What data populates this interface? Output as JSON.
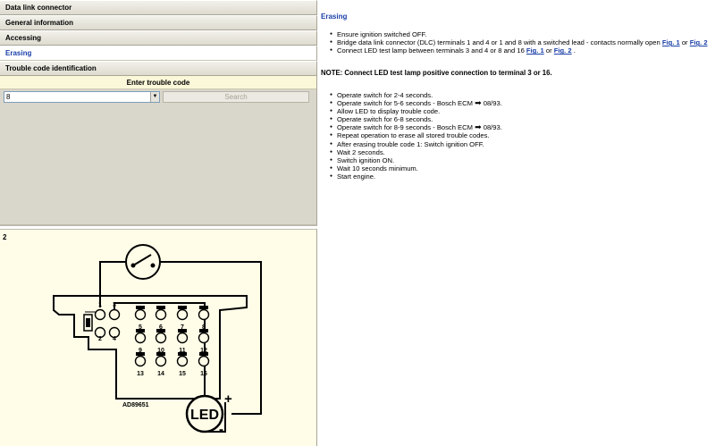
{
  "nav": {
    "items": [
      {
        "label": "Data link connector",
        "active": false
      },
      {
        "label": "General information",
        "active": false
      },
      {
        "label": "Accessing",
        "active": false
      },
      {
        "label": "Erasing",
        "active": true
      },
      {
        "label": "Trouble code identification",
        "active": false
      }
    ]
  },
  "trouble_code": {
    "header": "Enter trouble code",
    "selected_value": "8",
    "search_label": "Search"
  },
  "diagram": {
    "figure_number": "2",
    "lamp_label": "LED",
    "plus": "+",
    "minus": "-",
    "ref_code": "AD89651",
    "pins": [
      "1",
      "2",
      "3",
      "4",
      "5",
      "6",
      "7",
      "8",
      "9",
      "10",
      "11",
      "12",
      "13",
      "14",
      "15",
      "16"
    ]
  },
  "content": {
    "title": "Erasing",
    "steps1": {
      "s0": "Ensure ignition switched OFF.",
      "s1": "Bridge data link connector (DLC) terminals 1 and 4 or 1 and 8 with a switched lead - contacts normally open",
      "s2": "Connect LED test lamp between terminals 3 and 4 or 8 and 16"
    },
    "links": {
      "fig1": "Fig. 1",
      "fig2": "Fig. 2",
      "or": "or",
      "period": "."
    },
    "note": "NOTE: Connect LED test lamp positive connection to terminal 3 or 16.",
    "steps2": {
      "s0": "Operate switch for 2-4 seconds.",
      "s1a": "Operate switch for 5-6 seconds - Bosch ECM",
      "s1b": "08/93.",
      "s2": "Allow LED to display trouble code.",
      "s3": "Operate switch for 6-8 seconds.",
      "s4a": "Operate switch for 8-9 seconds - Bosch ECM",
      "s4b": "08/93.",
      "s5": "Repeat operation to erase all stored trouble codes.",
      "s6": "After erasing trouble code 1: Switch ignition OFF.",
      "s7": "Wait 2 seconds.",
      "s8": "Switch ignition ON.",
      "s9": "Wait 10 seconds minimum.",
      "s10": "Start engine."
    },
    "arrow_glyph": "➡"
  },
  "colors": {
    "link": "#1a3fa8",
    "panel": "#d9d6cb",
    "diagram_bg": "#fffde8",
    "header_bg": "#fbf7d9"
  }
}
